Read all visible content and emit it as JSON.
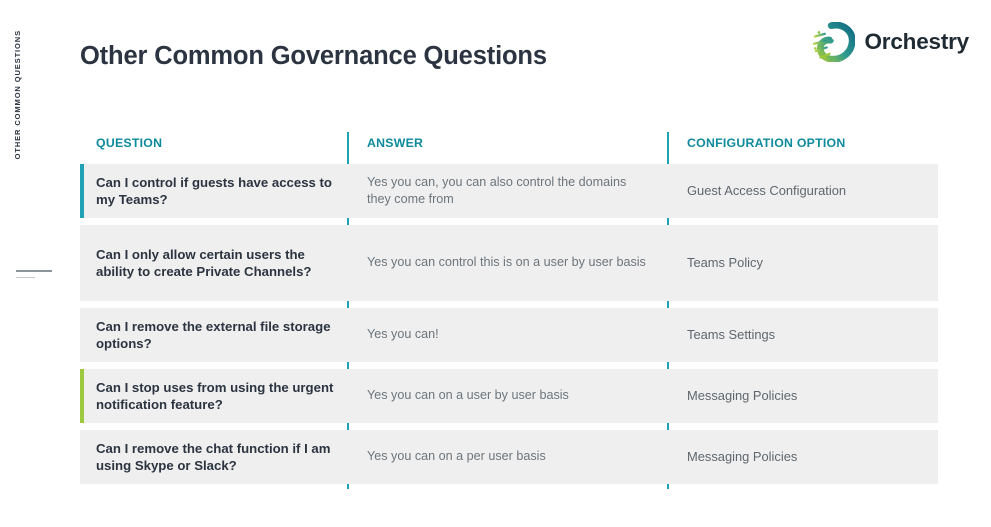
{
  "sidebar": {
    "vertical_label": "OTHER COMMON QUESTIONS"
  },
  "brand": {
    "name": "Orchestry",
    "logo_icon": "orchestry-comet-logo-icon",
    "teal": "#13788f",
    "green": "#97c93d"
  },
  "header": {
    "title": "Other Common Governance Questions"
  },
  "table": {
    "columns": [
      "QUESTION",
      "ANSWER",
      "CONFIGURATION OPTION"
    ],
    "accent_teal": "#1fa3b4",
    "accent_green": "#9dc83f",
    "rows": [
      {
        "question": "Can I control if guests have access to my Teams?",
        "answer": "Yes you can, you can also control the domains they come from",
        "configuration": "Guest Access Configuration",
        "accent": "#1fa3b4"
      },
      {
        "question": "Can I only allow certain users the ability to create Private Channels?",
        "answer": "Yes you can control this is on a user by user basis",
        "configuration": "Teams Policy",
        "accent": "none"
      },
      {
        "question": "Can I remove the external file storage options?",
        "answer": "Yes you can!",
        "configuration": "Teams Settings",
        "accent": "none"
      },
      {
        "question": "Can I stop uses from using the urgent notification feature?",
        "answer": "Yes you can on a user by user basis",
        "configuration": "Messaging Policies",
        "accent": "#9dc83f"
      },
      {
        "question": "Can I remove the chat function if I am using Skype or Slack?",
        "answer": "Yes you can on a per user basis",
        "configuration": "Messaging Policies",
        "accent": "none"
      }
    ]
  }
}
